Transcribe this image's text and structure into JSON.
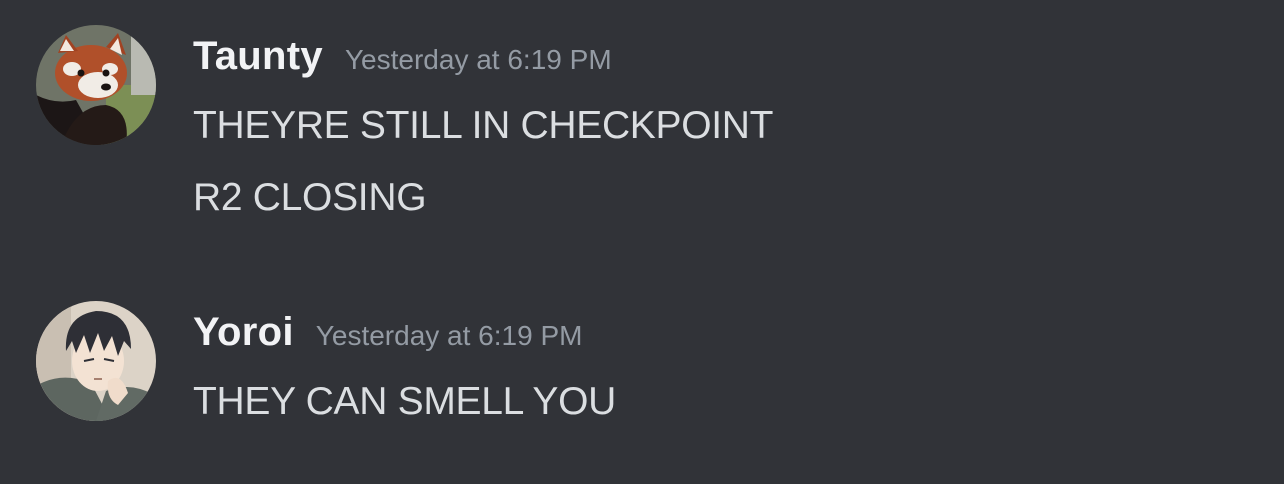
{
  "colors": {
    "background": "#313338",
    "username": "#f2f3f5",
    "timestamp": "#949ba4",
    "message_text": "#dbdee1"
  },
  "messages": [
    {
      "author": "Taunty",
      "avatar_icon": "red-panda-avatar",
      "timestamp": "Yesterday at 6:19 PM",
      "lines": [
        "THEYRE STILL IN CHECKPOINT",
        "R2 CLOSING"
      ]
    },
    {
      "author": "Yoroi",
      "avatar_icon": "anime-character-avatar",
      "timestamp": "Yesterday at 6:19 PM",
      "lines": [
        "THEY CAN SMELL YOU"
      ]
    }
  ]
}
